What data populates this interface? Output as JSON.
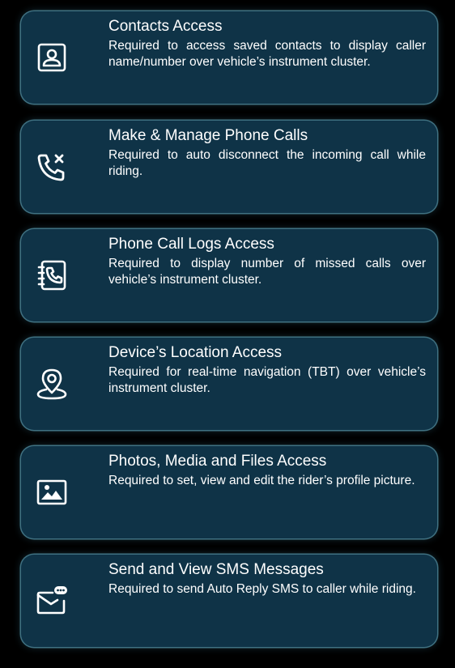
{
  "permissions": [
    {
      "title": "Contacts Access",
      "description": "Required to access saved contacts to display caller name/number over vehicle’s instrument cluster.",
      "icon": "contact-card-icon"
    },
    {
      "title": "Make & Manage Phone Calls",
      "description": "Required to auto disconnect the incoming call while riding.",
      "icon": "phone-disconnect-icon"
    },
    {
      "title": "Phone Call Logs Access",
      "description": "Required to display number of missed calls over vehicle’s instrument cluster.",
      "icon": "call-log-book-icon"
    },
    {
      "title": "Device’s Location Access",
      "description": "Required for real-time navigation (TBT) over vehicle’s instrument cluster.",
      "icon": "location-pin-icon"
    },
    {
      "title": "Photos, Media and Files Access",
      "description": "Required to set, view and edit the rider’s profile picture.",
      "icon": "image-icon"
    },
    {
      "title": "Send and View SMS Messages",
      "description": "Required to send Auto Reply SMS to caller while riding.",
      "icon": "sms-envelope-icon"
    }
  ],
  "colors": {
    "background": "#000000",
    "card": "#0f3347",
    "card_glow": "#6ebed7",
    "text": "#ffffff"
  }
}
